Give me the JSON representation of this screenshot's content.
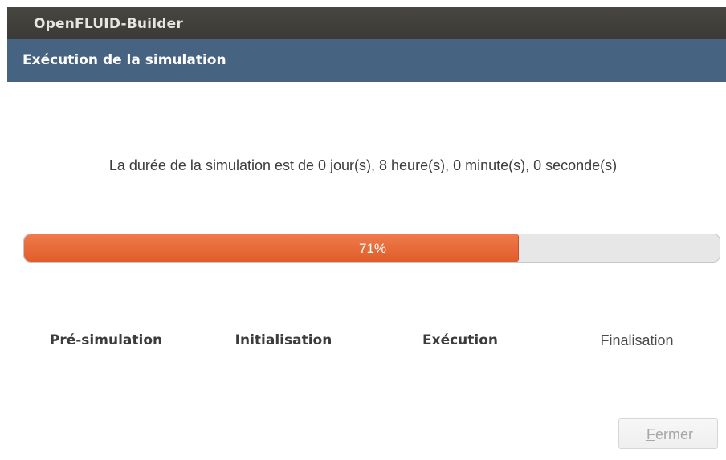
{
  "window": {
    "title": "OpenFLUID-Builder"
  },
  "dialog": {
    "header": "Exécution de la simulation",
    "duration_text": "La durée de la simulation est de 0 jour(s), 8 heure(s), 0 minute(s), 0 seconde(s)",
    "progress": {
      "percent": 71,
      "label": "71%",
      "fill_color": "#e8693a"
    },
    "stages": [
      {
        "label": "Pré-simulation",
        "state": "done"
      },
      {
        "label": "Initialisation",
        "state": "done"
      },
      {
        "label": "Exécution",
        "state": "done"
      },
      {
        "label": "Finalisation",
        "state": "pending"
      }
    ],
    "close_button": {
      "mnemonic": "F",
      "rest": "ermer",
      "enabled": false
    }
  },
  "colors": {
    "titlebar": "#3e3d39",
    "header": "#476382",
    "progress_track": "#e7e7e7"
  }
}
